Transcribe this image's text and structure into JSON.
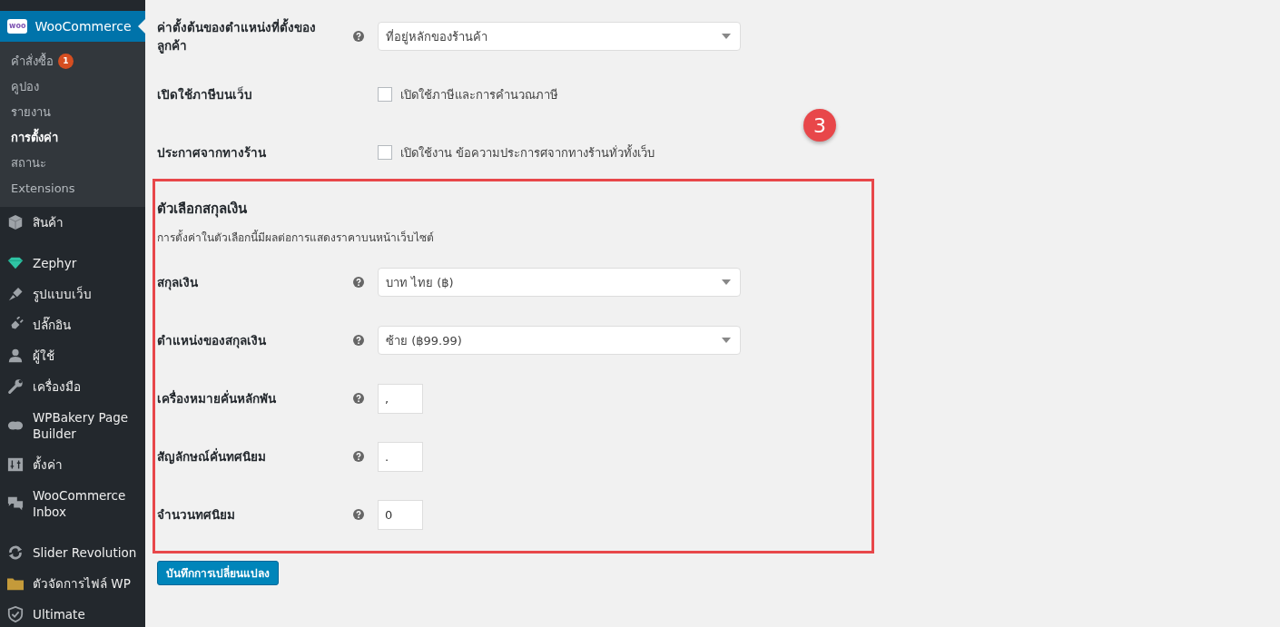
{
  "sidebar": {
    "active_menu": {
      "label": "WooCommerce",
      "logo_text": "woo",
      "selected": true
    },
    "submenu": [
      {
        "label": "คำสั่งซื้อ",
        "badge": "1",
        "selected": false
      },
      {
        "label": "คูปอง",
        "selected": false
      },
      {
        "label": "รายงาน",
        "selected": false
      },
      {
        "label": "การตั้งค่า",
        "selected": true
      },
      {
        "label": "สถานะ",
        "selected": false
      },
      {
        "label": "Extensions",
        "selected": false
      }
    ],
    "menu_groups": [
      [
        {
          "label": "สินค้า"
        }
      ],
      [
        {
          "label": "Zephyr"
        },
        {
          "label": "รูปแบบเว็บ"
        },
        {
          "label": "ปลั๊กอิน"
        },
        {
          "label": "ผู้ใช้"
        },
        {
          "label": "เครื่องมือ"
        },
        {
          "label": "WPBakery Page Builder"
        },
        {
          "label": "ตั้งค่า"
        },
        {
          "label": "WooCommerce Inbox"
        }
      ],
      [
        {
          "label": "Slider Revolution"
        },
        {
          "label": "ตัวจัดการไฟล์ WP"
        },
        {
          "label": "Ultimate"
        }
      ]
    ]
  },
  "settings": [
    {
      "kind": "select",
      "label": "ค่าตั้งต้นของตำแหน่งที่ตั้งของลูกค้า",
      "help": true,
      "value": "ที่อยู่หลักของร้านค้า"
    },
    {
      "kind": "checkbox",
      "label": "เปิดใช้ภาษีบนเว็บ",
      "help": false,
      "checked": false,
      "text": "เปิดใช้ภาษีและการคำนวณภาษี"
    },
    {
      "kind": "checkbox",
      "label": "ประกาศจากทางร้าน",
      "help": false,
      "checked": false,
      "text": "เปิดใช้งาน ข้อความประการศจากทางร้านทั่วทั้งเว็บ"
    }
  ],
  "currency_section": {
    "title": "ตัวเลือกสกุลเงิน",
    "description": "การตั้งค่าในตัวเลือกนี้มีผลต่อการแสดงราคาบนหน้าเว็บไซต์",
    "highlighted": true,
    "settings": [
      {
        "kind": "select",
        "label": "สกุลเงิน",
        "help": true,
        "value": "บาท ไทย (฿)"
      },
      {
        "kind": "select",
        "label": "ตำแหน่งของสกุลเงิน",
        "help": true,
        "value": "ซ้าย (฿99.99)"
      },
      {
        "kind": "text",
        "label": "เครื่องหมายคั่นหลักพัน",
        "help": true,
        "value": ","
      },
      {
        "kind": "text",
        "label": "สัญลักษณ์คั่นทศนิยม",
        "help": true,
        "value": "."
      },
      {
        "kind": "text",
        "label": "จำนวนทศนิยม",
        "help": true,
        "value": "0"
      }
    ]
  },
  "save_button": "บันทึกการเปลี่ยนแปลง",
  "callout": "3"
}
